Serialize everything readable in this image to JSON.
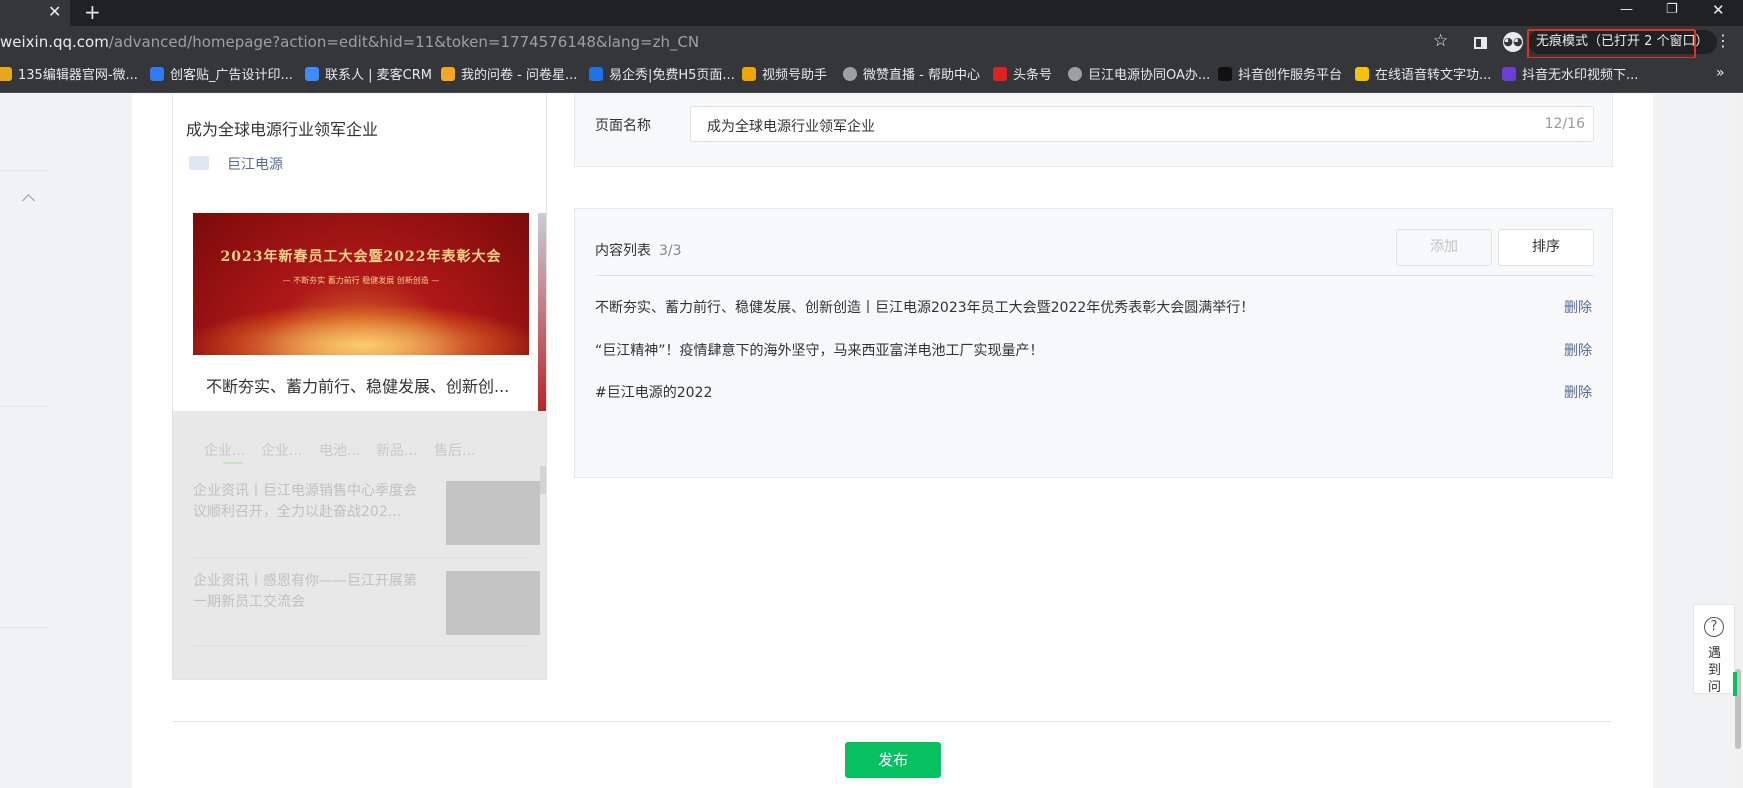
{
  "browser": {
    "tab_close": "✕",
    "new_tab": "+",
    "url_host": "weixin.qq.com",
    "url_rest": "/advanced/homepage?action=edit&hid=11&token=1774576148&lang=zh_CN",
    "incognito_label": "无痕模式（已打开 2 个窗口）",
    "bookmarks": [
      {
        "label": "135编辑器官网-微...",
        "color": "#e6a817"
      },
      {
        "label": "创客贴_广告设计印...",
        "color": "#2f7bf5"
      },
      {
        "label": "联系人 | 麦客CRM",
        "color": "#3d8bfd"
      },
      {
        "label": "我的问卷 - 问卷星...",
        "color": "#f5a623"
      },
      {
        "label": "易企秀|免费H5页面...",
        "color": "#1a73e8"
      },
      {
        "label": "视频号助手",
        "color": "#f0a500"
      },
      {
        "label": "微赞直播 - 帮助中心",
        "color": "#9aa0a6"
      },
      {
        "label": "头条号",
        "color": "#e02020"
      },
      {
        "label": "巨江电源协同OA办...",
        "color": "#9aa0a6"
      },
      {
        "label": "抖音创作服务平台",
        "color": "#111111"
      },
      {
        "label": "在线语音转文字功...",
        "color": "#f5c400"
      },
      {
        "label": "抖音无水印视频下...",
        "color": "#6b3fd4"
      }
    ]
  },
  "preview": {
    "title": "成为全球电源行业领军企业",
    "brand": "巨江电源",
    "banner_title": "2023年新春员工大会暨2022年表彰大会",
    "banner_subtitle": "— 不断夯实   蓄力前行   稳健发展   创新创造 —",
    "card_caption": "不断夯实、蓄力前行、稳健发展、创新创...",
    "tabs": [
      "企业...",
      "企业...",
      "电池...",
      "新品...",
      "售后..."
    ],
    "articles": [
      "企业资讯丨巨江电源销售中心季度会议顺利召开，全力以赴奋战202...",
      "企业资讯丨感恩有你——巨江开展第一期新员工交流会"
    ]
  },
  "form": {
    "page_name_label": "页面名称",
    "page_name_value": "成为全球电源行业领军企业",
    "page_name_count": "12/16",
    "content_list_label": "内容列表",
    "content_count": "3/3",
    "add_button": "添加",
    "sort_button": "排序",
    "items": [
      {
        "title": "不断夯实、蓄力前行、稳健发展、创新创造丨巨江电源2023年员工大会暨2022年优秀表彰大会圆满举行！",
        "action": "删除"
      },
      {
        "title": "“巨江精神”！疫情肆意下的海外坚守，马来西亚富洋电池工厂实现量产！",
        "action": "删除"
      },
      {
        "title": "#巨江电源的2022",
        "action": "删除"
      }
    ],
    "publish_button": "发布"
  },
  "help": {
    "icon_text": "?",
    "label": "遇到问"
  }
}
